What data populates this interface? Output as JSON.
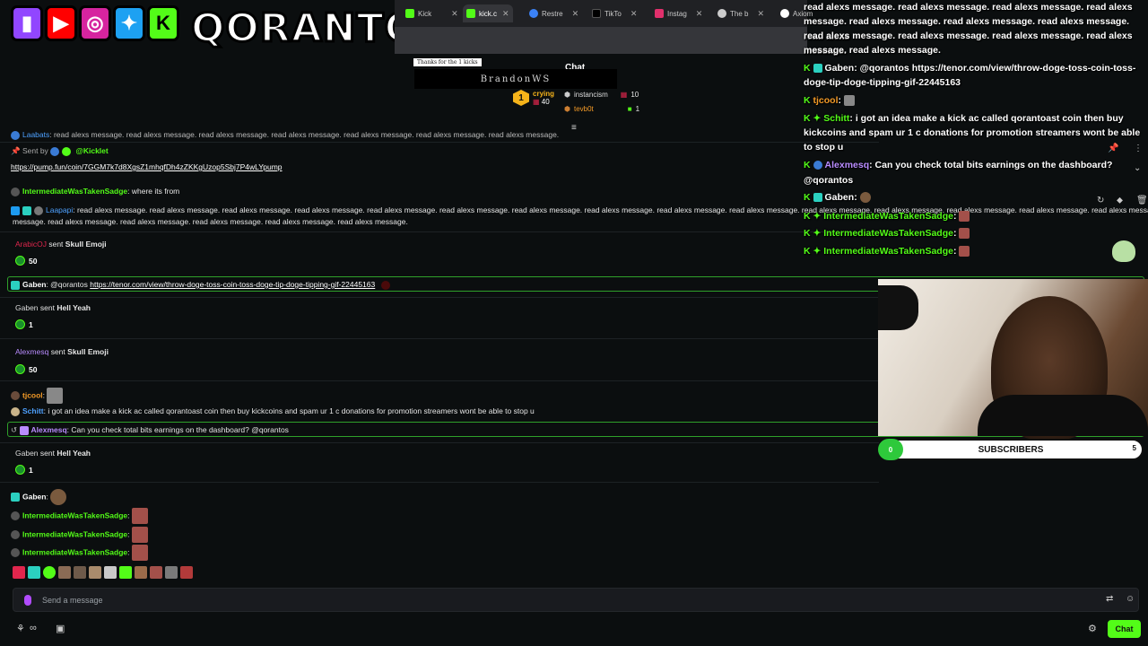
{
  "browser": {
    "tabs": [
      {
        "label": "Kick",
        "color": "#53fc18",
        "active": false
      },
      {
        "label": "kick.c",
        "color": "#53fc18",
        "active": true
      },
      {
        "label": "Restre",
        "color": "#3b82f6",
        "active": false
      },
      {
        "label": "TikTo",
        "color": "#000000",
        "active": false
      },
      {
        "label": "Instag",
        "color": "#e1306c",
        "active": false
      },
      {
        "label": "The b",
        "color": "#cccccc",
        "active": false
      },
      {
        "label": "Axiom",
        "color": "#ffffff",
        "active": false
      }
    ]
  },
  "brand": {
    "name": "QORANTOS",
    "logos": [
      "twitch-icon",
      "youtube-icon",
      "instagram-icon",
      "twitter-icon",
      "kick-icon"
    ],
    "colors": {
      "twitch": "#9146ff",
      "youtube": "#ff0000",
      "instagram": "#d6249f",
      "twitter": "#1da1f2",
      "kick": "#53fc18"
    }
  },
  "header": {
    "thanks_banner": "Thanks for the 1 kicks",
    "chat_title": "Chat",
    "donor_name": "BrandonWS",
    "leaderboard": [
      {
        "rank": "1",
        "name": "crying",
        "amount": "40"
      },
      {
        "name": "instancism",
        "amount": "10"
      },
      {
        "name": "tevb0t",
        "amount": "1"
      }
    ]
  },
  "messages": {
    "top_partial": {
      "user": "Laabats",
      "text": ": read alexs message. read alexs message. read alexs message. read alexs message. read alexs message. read alexs message. read alexs message."
    },
    "pinned": {
      "sent_by_label": "Sent by",
      "sender": "@Kicklet",
      "link": "https://pump.fun/coin/7GGM7k7d8XgsZ1mhqfDh4zZKKgUzop5Sbj7P4wLYpump"
    },
    "m1": {
      "user": "IntermediateWasTakenSadge",
      "text": ": where its from"
    },
    "m2": {
      "user": "Laapapi",
      "text": ": read alexs message. read alexs message. read alexs message. read alexs message. read alexs message. read alexs message. read alexs message. read alexs message. read alexs message. read alexs message. read alexs message. read alexs message. read alexs message. read alexs message. read alexs message.",
      "text2": "message. read alexs message. read alexs message. read alexs message. read alexs message. read alexs message."
    },
    "gift1": {
      "user": "ArabicOJ",
      "action": "sent",
      "item": "Skull Emoji",
      "amount": "50"
    },
    "highlight1": {
      "user": "Gaben",
      "prefix": ": @qorantos ",
      "link": "https://tenor.com/view/throw-doge-toss-coin-toss-doge-tip-doge-tipping-gif-22445163"
    },
    "gift2": {
      "user": "Gaben",
      "action": "sent",
      "item": "Hell Yeah",
      "amount": "1"
    },
    "gift3": {
      "user": "Alexmesq",
      "action": "sent",
      "item": "Skull Emoji",
      "amount": "50"
    },
    "m3": {
      "user": "tjcool",
      "text": ":"
    },
    "m4": {
      "user": "Schitt",
      "text": ": i got an idea make a kick ac called qorantoast coin then buy kickcoins and spam ur 1 c donations for promotion streamers wont be able to stop u"
    },
    "highlight2": {
      "user": "Alexmesq",
      "text": ": Can you check total bits earnings on the dashboard? @qorantos"
    },
    "gift4": {
      "user": "Gaben",
      "action": "sent",
      "item": "Hell Yeah",
      "amount": "1"
    },
    "m5": {
      "user": "Gaben",
      "text": ":"
    },
    "m6": {
      "user": "IntermediateWasTakenSadge",
      "text": ":"
    },
    "m7": {
      "user": "IntermediateWasTakenSadge",
      "text": ":"
    },
    "m8": {
      "user": "IntermediateWasTakenSadge",
      "text": ":"
    }
  },
  "composer": {
    "placeholder": "Send a message",
    "chat_button": "Chat"
  },
  "overlay": {
    "spam1": "read alexs message. read alexs message. read alexs message. read alexs",
    "spam2": "message. read alexs message. read alexs message. read alexs message. read alexs",
    "spam3": "read alexs message. read alexs message. read alexs message. read alexs message.",
    "spam4": "message. read alexs message.",
    "gaben_user": "Gaben",
    "gaben_text": ": @qorantos https://tenor.com/view/throw-doge-toss-coin-toss-",
    "gaben_text2": "doge-tip-doge-tipping-gif-22445163",
    "tjcool_user": "tjcool",
    "tjcool_text": ":",
    "schitt_user": "Schitt",
    "schitt_text": ": i got an idea make a kick ac called qorantoast coin then buy",
    "schitt_text2": "kickcoins and spam ur 1 c donations for promotion streamers wont be able",
    "schitt_text3": "to stop u",
    "alex_user": "Alexmesq",
    "alex_text": ": Can you check total bits earnings on the dashboard?",
    "alex_text2": "@qorantos",
    "gaben2_user": "Gaben",
    "gaben2_text": ":",
    "inter_user": "IntermediateWasTakenSadge",
    "inter_text": ":"
  },
  "subs": {
    "label": "SUBSCRIBERS",
    "current": "0",
    "goal": "5"
  }
}
